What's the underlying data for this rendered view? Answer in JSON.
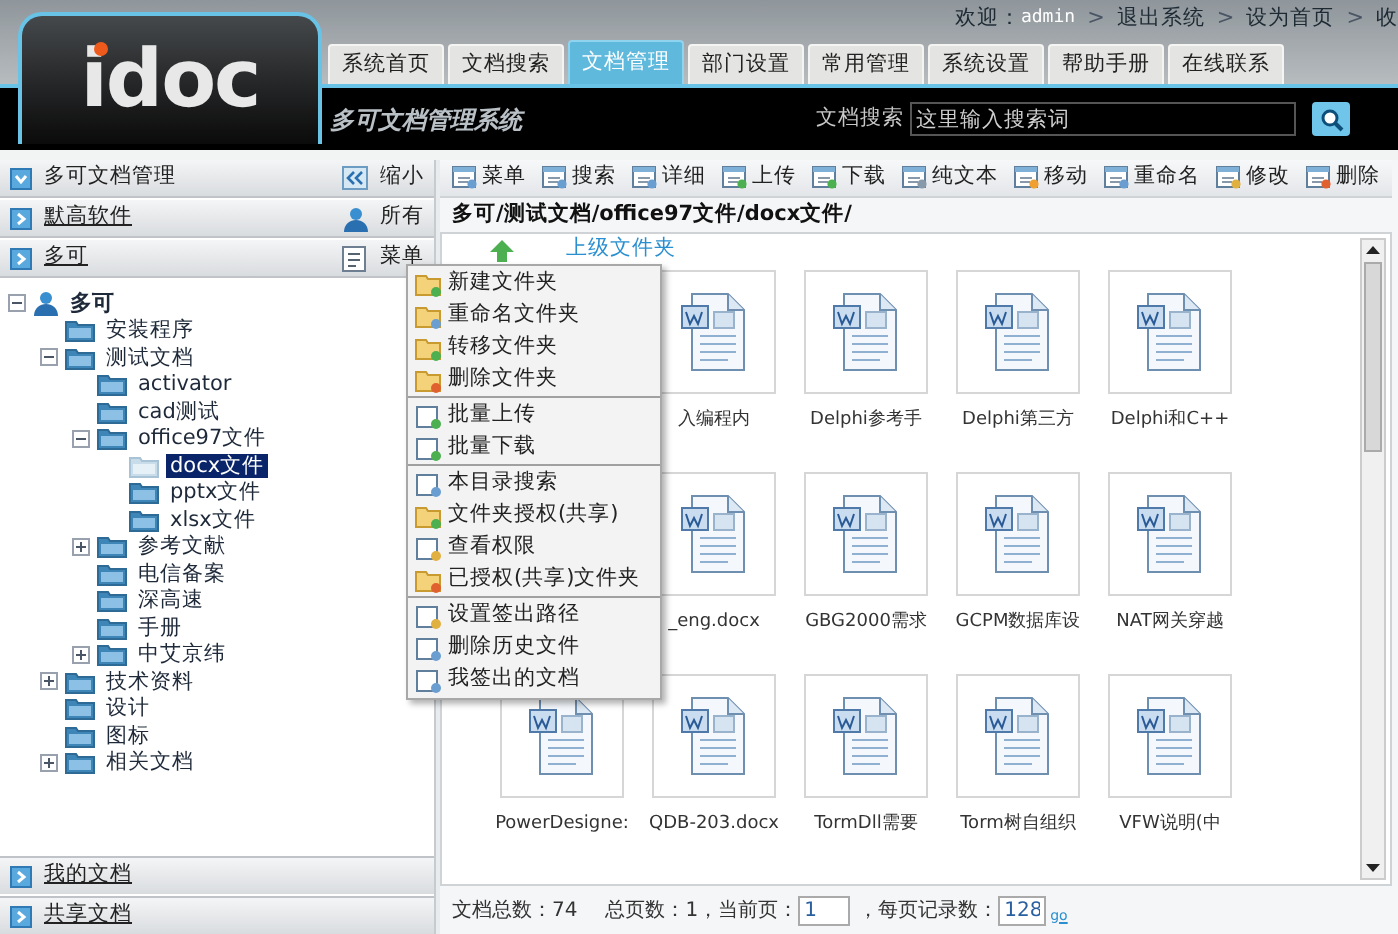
{
  "logo": "idoc",
  "header_links": [
    {
      "label": "欢迎：",
      "kind": "text"
    },
    {
      "label": "admin",
      "kind": "user"
    },
    {
      "label": ">",
      "kind": "separator"
    },
    {
      "label": "退出系统",
      "kind": "link"
    },
    {
      "label": ">",
      "kind": "separator"
    },
    {
      "label": "设为首页",
      "kind": "link"
    },
    {
      "label": ">",
      "kind": "separator"
    },
    {
      "label": "收",
      "kind": "link"
    }
  ],
  "tabs": [
    {
      "label": "系统首页",
      "selected": false
    },
    {
      "label": "文档搜索",
      "selected": false
    },
    {
      "label": "文档管理",
      "selected": true
    },
    {
      "label": "部门设置",
      "selected": false
    },
    {
      "label": "常用管理",
      "selected": false
    },
    {
      "label": "系统设置",
      "selected": false
    },
    {
      "label": "帮助手册",
      "selected": false
    },
    {
      "label": "在线联系",
      "selected": false
    }
  ],
  "system_title": "多可文档管理系统",
  "search": {
    "label": "文档搜索",
    "placeholder": "这里输入搜索词"
  },
  "sidebar": {
    "sections": [
      {
        "label": "多可文档管理",
        "expanded": true,
        "link": false,
        "action": "缩小",
        "kind": "collapse"
      },
      {
        "label": "默高软件",
        "expanded": false,
        "link": true,
        "action": "所有",
        "kind": "user"
      },
      {
        "label": "多可",
        "expanded": false,
        "link": true,
        "action": "菜单",
        "kind": "menu"
      }
    ],
    "tree": [
      {
        "label": "多可",
        "kind": "user",
        "expanded": true,
        "selected": false,
        "children": [
          {
            "label": "安装程序",
            "selected": false
          },
          {
            "label": "测试文档",
            "expanded": true,
            "selected": false,
            "children": [
              {
                "label": "activator",
                "selected": false
              },
              {
                "label": "cad测试",
                "selected": false
              },
              {
                "label": "office97文件",
                "expanded": true,
                "selected": false,
                "children": [
                  {
                    "label": "docx文件",
                    "selected": true
                  },
                  {
                    "label": "pptx文件",
                    "selected": false
                  },
                  {
                    "label": "xlsx文件",
                    "selected": false
                  }
                ]
              },
              {
                "label": "参考文献",
                "expanded": false,
                "selected": false
              },
              {
                "label": "电信备案",
                "selected": false
              },
              {
                "label": "深高速",
                "selected": false
              },
              {
                "label": "手册",
                "selected": false
              },
              {
                "label": "中艾京纬",
                "expanded": false,
                "selected": false
              }
            ]
          },
          {
            "label": "技术资料",
            "expanded": false,
            "selected": false
          },
          {
            "label": "设计",
            "selected": false
          },
          {
            "label": "图标",
            "selected": false
          },
          {
            "label": "相关文档",
            "expanded": false,
            "selected": false
          }
        ]
      }
    ],
    "bottom_sections": [
      {
        "label": "我的文档",
        "expanded": false
      },
      {
        "label": "共享文档",
        "expanded": false
      }
    ]
  },
  "toolbar": [
    "菜单",
    "搜索",
    "详细",
    "上传",
    "下载",
    "纯文本",
    "移动",
    "重命名",
    "修改",
    "删除"
  ],
  "path": "多可/测试文档/office97文件/docx文件/",
  "up_folder": "上级文件夹",
  "files": [
    {
      "kind": "hidden"
    },
    {
      "name": "入编程内",
      "kind": "doc"
    },
    {
      "name": "Delphi参考手",
      "kind": "doc"
    },
    {
      "name": "Delphi第三方",
      "kind": "doc"
    },
    {
      "name": "Delphi和C++",
      "kind": "doc"
    },
    {
      "kind": "hidden"
    },
    {
      "name": "_eng.docx",
      "kind": "doc"
    },
    {
      "name": "GBG2000需求",
      "kind": "doc"
    },
    {
      "name": "GCPM数据库设",
      "kind": "doc"
    },
    {
      "name": "NAT网关穿越",
      "kind": "doc"
    },
    {
      "name": "PowerDesigne:",
      "kind": "doc"
    },
    {
      "name": "QDB-203.docx",
      "kind": "doc"
    },
    {
      "name": "TormDll需要",
      "kind": "doc"
    },
    {
      "name": "Torm树自组织",
      "kind": "doc"
    },
    {
      "name": "VFW说明(中",
      "kind": "doc"
    }
  ],
  "footer": {
    "total": "文档总数：74",
    "pages": "总页数：1，",
    "current_label": "当前页：",
    "current": "1",
    "per_page_label": "，每页记录数：",
    "per_page": "128",
    "go": "go"
  },
  "context_menu": [
    [
      "新建文件夹",
      "重命名文件夹",
      "转移文件夹",
      "删除文件夹"
    ],
    [
      "批量上传",
      "批量下载"
    ],
    [
      "本目录搜索",
      "文件夹授权(共享)",
      "查看权限",
      "已授权(共享)文件夹"
    ],
    [
      "设置签出路径",
      "删除历史文件",
      "我签出的文档"
    ]
  ]
}
